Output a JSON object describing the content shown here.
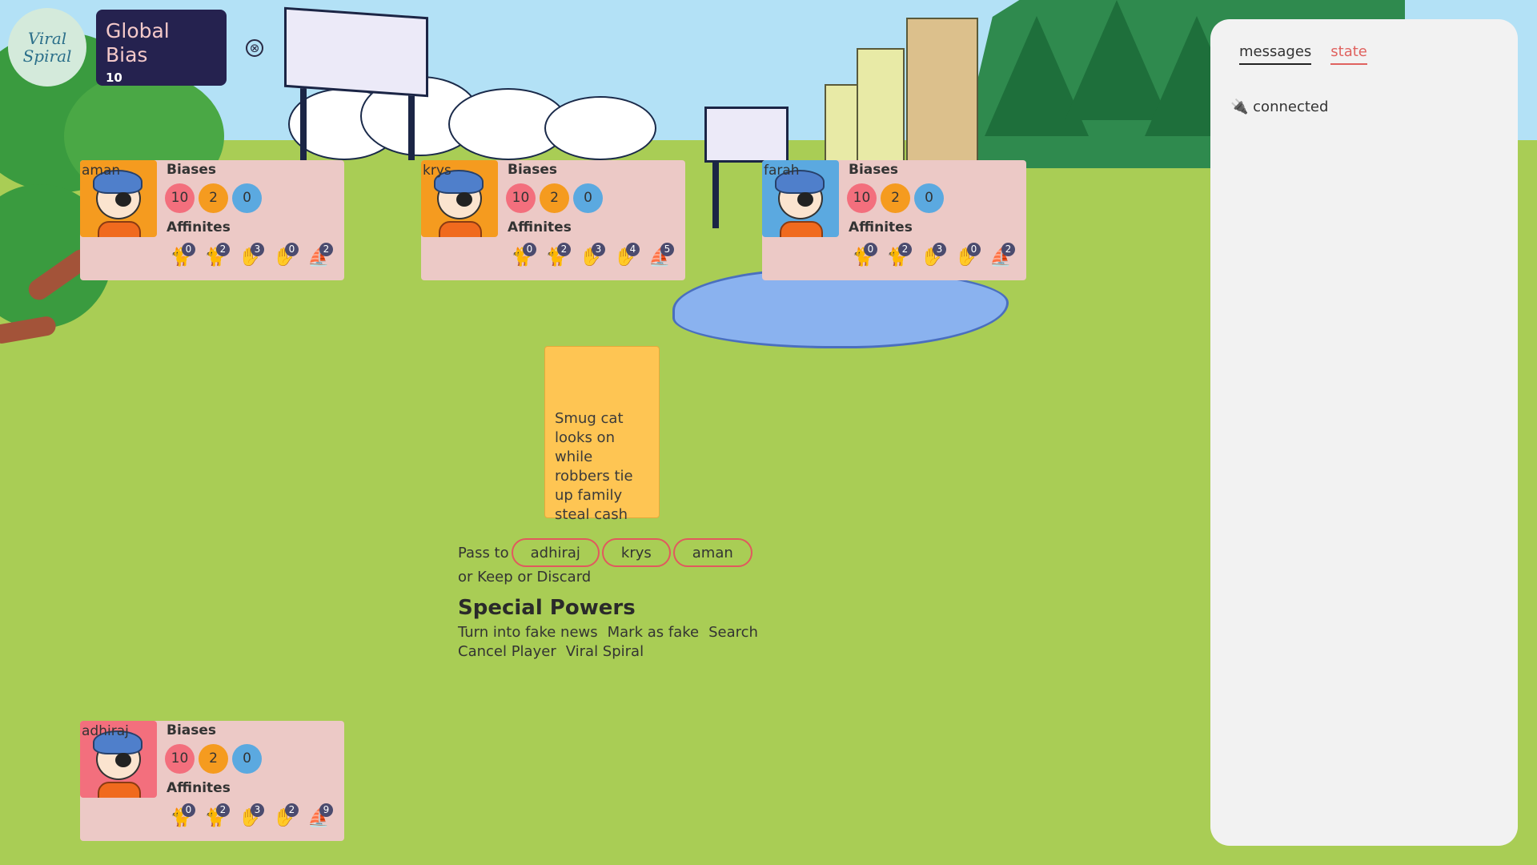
{
  "app": {
    "logo_line1": "Viral",
    "logo_line2": "Spiral"
  },
  "global_bias": {
    "title": "Global Bias",
    "value": "10"
  },
  "close_icon": "⊗",
  "labels": {
    "biases": "Biases",
    "affinites": "Affinites"
  },
  "colors": {
    "bias_red": "#f36f7d",
    "bias_orange": "#f59b1f",
    "bias_blue": "#5ba9e0",
    "panel_bg": "#25224f",
    "card_bg": "#ecc9c6",
    "topic_card": "#fec553",
    "accent": "#e0625f"
  },
  "players": [
    {
      "name": "aman",
      "avatar_bg": "#f59b1f",
      "biases": [
        "10",
        "2",
        "0"
      ],
      "affinities": [
        {
          "icon": "cat-icon",
          "count": "0"
        },
        {
          "icon": "cat-icon",
          "count": "2"
        },
        {
          "icon": "hand-icon",
          "count": "3"
        },
        {
          "icon": "hand-icon",
          "count": "0"
        },
        {
          "icon": "boat-icon",
          "count": "2"
        }
      ]
    },
    {
      "name": "krys",
      "avatar_bg": "#f59b1f",
      "biases": [
        "10",
        "2",
        "0"
      ],
      "affinities": [
        {
          "icon": "cat-icon",
          "count": "0"
        },
        {
          "icon": "cat-icon",
          "count": "2"
        },
        {
          "icon": "hand-icon",
          "count": "3"
        },
        {
          "icon": "hand-icon",
          "count": "4"
        },
        {
          "icon": "boat-icon",
          "count": "5"
        }
      ]
    },
    {
      "name": "farah",
      "avatar_bg": "#5ba9e0",
      "biases": [
        "10",
        "2",
        "0"
      ],
      "affinities": [
        {
          "icon": "cat-icon",
          "count": "0"
        },
        {
          "icon": "cat-icon",
          "count": "2"
        },
        {
          "icon": "hand-icon",
          "count": "3"
        },
        {
          "icon": "hand-icon",
          "count": "0"
        },
        {
          "icon": "boat-icon",
          "count": "2"
        }
      ]
    },
    {
      "name": "adhiraj",
      "avatar_bg": "#f36f7d",
      "biases": [
        "10",
        "2",
        "0"
      ],
      "affinities": [
        {
          "icon": "cat-icon",
          "count": "0"
        },
        {
          "icon": "cat-icon",
          "count": "2"
        },
        {
          "icon": "hand-icon",
          "count": "3"
        },
        {
          "icon": "hand-icon",
          "count": "2"
        },
        {
          "icon": "boat-icon",
          "count": "9"
        }
      ]
    }
  ],
  "topic_card": {
    "text": "Smug cat looks on while robbers tie up family steal cash"
  },
  "actions": {
    "pass_to_label": "Pass to",
    "pass_targets": [
      "adhiraj",
      "krys",
      "aman"
    ],
    "or_label": "or",
    "keep_label": "Keep",
    "discard_label": "Discard"
  },
  "special_powers": {
    "title": "Special Powers",
    "items": [
      "Turn into fake news",
      "Mark as fake",
      "Search",
      "Cancel Player",
      "Viral Spiral"
    ]
  },
  "side_panel": {
    "tabs": [
      "messages",
      "state"
    ],
    "status_icon": "plug-icon",
    "status_text": "connected"
  }
}
